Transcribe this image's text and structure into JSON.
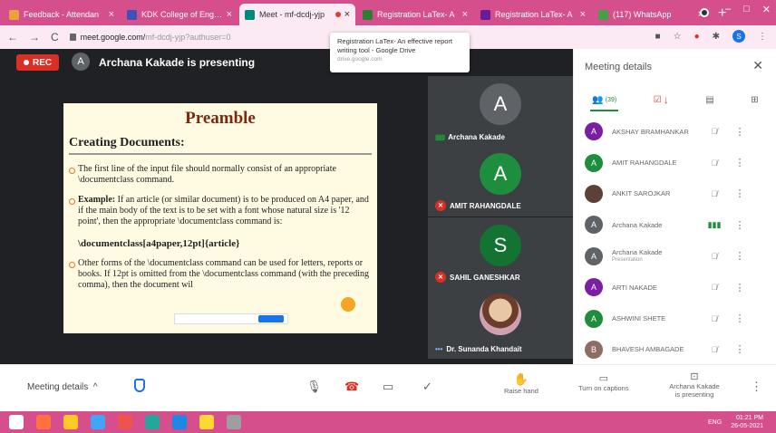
{
  "browser": {
    "tabs": [
      {
        "title": "Feedback - Attendan",
        "fav_color": "#e8a33b",
        "active": false
      },
      {
        "title": "KDK College of Engine",
        "fav_color": "#3f51b5",
        "active": false
      },
      {
        "title": "Meet - mf-dcdj-yjp",
        "fav_color": "#00897b",
        "active": true
      },
      {
        "title": "Registration LaTex- A",
        "fav_color": "#2e7d32",
        "active": false
      },
      {
        "title": "Registration LaTex- A",
        "fav_color": "#6a1b9a",
        "active": false
      },
      {
        "title": "(117) WhatsApp",
        "fav_color": "#43a047",
        "active": false
      }
    ],
    "url_host": "meet.google.com/",
    "url_path": "mf-dcdj-yjp?authuser=0"
  },
  "tooltip": {
    "title": "Registration LaTex- An effective report writing tool - Google Drive",
    "source": "drive.google.com"
  },
  "meet": {
    "rec_label": "REC",
    "presenter_initial": "A",
    "presenting_text": "Archana Kakade is presenting"
  },
  "slide": {
    "title": "Preamble",
    "heading": "Creating Documents:",
    "bullet1": "The first line of the input file should normally consist of an appropriate \\documentclass command.",
    "bullet2_lead": "Example:",
    "bullet2": " If an article (or similar document) is to be produced on A4 paper, and if the main body of the text is to be set with a font whose natural size is '12 point', then the appropriate \\documentclass command is:",
    "command": "\\documentclass[a4paper,12pt]{article}",
    "bullet3": "Other forms of the \\documentclass command can be used for letters, reports or books. If 12pt is omitted from the \\documentclass command (with the preceding comma), then the document wil"
  },
  "tiles": [
    {
      "name": "Archana Kakade",
      "initial": "A",
      "color": "#5f6368",
      "status": "speaking"
    },
    {
      "name": "AMIT RAHANGDALE",
      "initial": "A",
      "color": "#1e8e3e",
      "status": "muted"
    },
    {
      "name": "SAHIL GANESHKAR",
      "initial": "S",
      "color": "#137333",
      "status": "muted"
    },
    {
      "name": "Dr. Sunanda Khandait",
      "initial": "",
      "color": "",
      "status": "more"
    }
  ],
  "panel": {
    "title": "Meeting details",
    "people_count": "(39)",
    "people": [
      {
        "name": "AKSHAY BRAMHANKAR",
        "sub": "",
        "initial": "A",
        "color": "#7b1fa2",
        "mic": "off"
      },
      {
        "name": "AMIT RAHANGDALE",
        "sub": "",
        "initial": "A",
        "color": "#1e8e3e",
        "mic": "off"
      },
      {
        "name": "ANKIT SAROJKAR",
        "sub": "",
        "initial": "",
        "color": "#5d4037",
        "mic": "off"
      },
      {
        "name": "Archana Kakade",
        "sub": "",
        "initial": "A",
        "color": "#5f6368",
        "mic": "on"
      },
      {
        "name": "Archana Kakade",
        "sub": "Presentation",
        "initial": "A",
        "color": "#5f6368",
        "mic": "off"
      },
      {
        "name": "ARTI NAKADE",
        "sub": "",
        "initial": "A",
        "color": "#7b1fa2",
        "mic": "off"
      },
      {
        "name": "ASHWINI SHETE",
        "sub": "",
        "initial": "A",
        "color": "#1e8e3e",
        "mic": "off"
      },
      {
        "name": "BHAVESH AMBAGADE",
        "sub": "",
        "initial": "B",
        "color": "#8d6e63",
        "mic": "off"
      }
    ]
  },
  "controls": {
    "meeting_details": "Meeting details",
    "raise_hand": "Raise hand",
    "captions": "Turn on captions",
    "presenting": "Archana Kakade is presenting"
  },
  "taskbar": {
    "lang": "ENG",
    "time": "01:21 PM",
    "date": "26-05-2021"
  }
}
